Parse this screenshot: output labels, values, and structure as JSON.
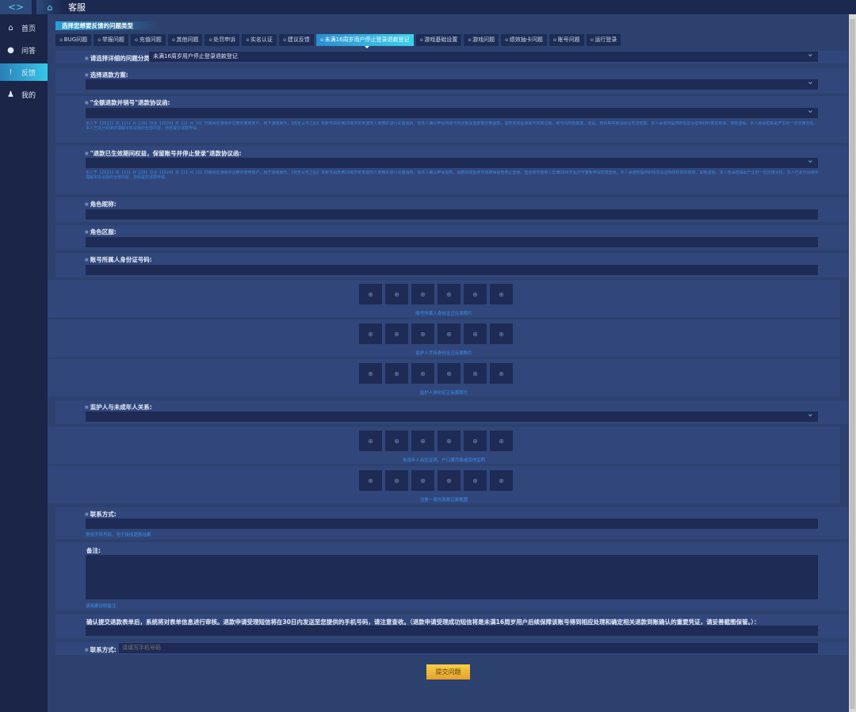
{
  "header": {
    "title": "客服"
  },
  "sidebar": {
    "items": [
      {
        "label": "首页",
        "icon": "home-icon"
      },
      {
        "label": "问答",
        "icon": "chat-icon"
      },
      {
        "label": "反馈",
        "icon": "feedback-icon"
      },
      {
        "label": "我的",
        "icon": "user-icon"
      }
    ],
    "active": "反馈"
  },
  "main": {
    "section_title": "选择您想要反馈的问题类型",
    "tabs": [
      "BUG问题",
      "举报问题",
      "充值问题",
      "其他问题",
      "处罚申诉",
      "实名认证",
      "建议反馈",
      "未满16周岁用户停止登录退款登记",
      "游戏基础设置",
      "游戏问题",
      "绩效抽卡问题",
      "账号问题",
      "运行登录"
    ],
    "active_tab": "未满16周岁用户停止登录退款登记",
    "category_label": "请选择详细的问题分类:",
    "category_value": "未满16周岁用户停止登录退款登记",
    "plan_label": "选择退款方案:",
    "agreement1_label": "\"全额退款并销号\"退款协议函:",
    "agreement1_text": "本人于【2021】年【11】月【28】日至【2024】年【1】月【1】日期间在游戏中注册并使用账户，用于游戏娱乐。【完全认可之后】本账号由未满16周岁的未成年人使用并进行充值消费。现本人确认申请将账号内全部充值金额全额退款，退款完成后该账号将被注销，账号内所有数据、道具、角色等将被清除且无法恢复。本人承诺所提供的信息及证明材料真实有效，如有虚假，本人愿承担由此产生的一切法律责任。本人已充分阅读并理解本协议函的全部内容，自愿提交退款申请。",
    "agreement2_label": "\"退款已生效期间权益，保留账号并停止登录\"退款协议函:",
    "agreement2_text": "本人于【2021】年【11】月【28】日至【2024】年【1】月【1】日期间在游戏中注册并使用账户，用于游戏娱乐。【完全认可之后】本账号由未满16周岁的未成年人使用并进行充值消费。现本人确认申请退款，退款完成后账号将被保留但停止登录，直至账号使用人年满16周岁后方可重新申请恢复登录。本人承诺所提供的信息及证明材料真实有效，如有虚假，本人愿承担由此产生的一切法律责任。本人已充分阅读并理解本协议函的全部内容，自愿提交退款申请。",
    "nickname_label": "角色昵称:",
    "server_label": "角色区服:",
    "id_label": "账号所属人身份证号码:",
    "uploads": [
      "账号所属人身份证正反面照片",
      "监护人手持身份证正反面照片",
      "监护人身份证正反面照片",
      "未成年人出生证明、户口簿页面或其他证明",
      "注册一周内消费记录截图"
    ],
    "relation_label": "监护人与未成年人关系:",
    "contact_label": "联系方式:",
    "contact_hint": "常用手机号码，用于接收退款结果",
    "remark_label": "备注:",
    "remark_hint": "请简要说明备注",
    "confirm_label": "确认提交退款表单后，系统将对表单信息进行审核。退款申请受理短信将在30日内发送至您提供的手机号码，请注意查收。（退款申请受理成功短信将是未满16周岁用户后续保障该账号得到相应处理和确定相关退款到账确认的重要凭证，请妥善截图保管。）：",
    "contact2_label": "联系方式:",
    "contact2_placeholder": "请填写手机号码",
    "submit_label": "提交问题"
  }
}
